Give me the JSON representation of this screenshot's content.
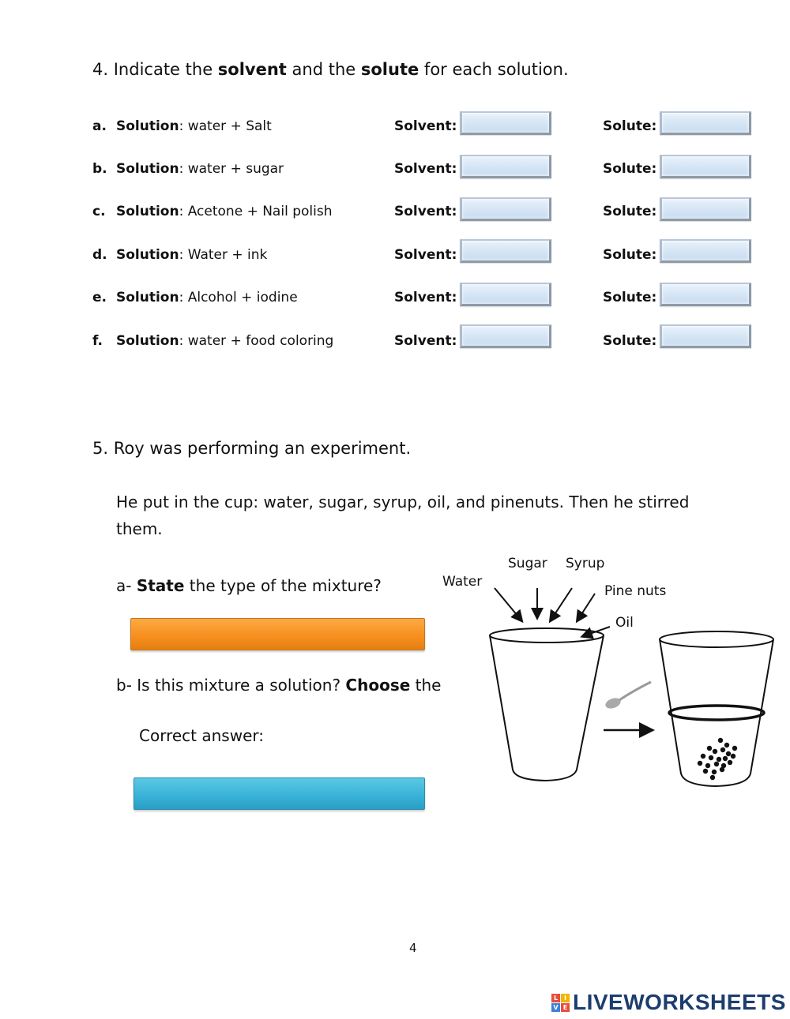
{
  "question4": {
    "number": "4.",
    "prefix": "Indicate the",
    "bold1": "solvent",
    "middle": "and the",
    "bold2": "solute",
    "suffix": "for each solution.",
    "solution_label": "Solution",
    "solvent_label": "Solvent:",
    "solute_label": "Solute:",
    "rows": [
      {
        "letter": "a.",
        "text": ": water + Salt"
      },
      {
        "letter": "b.",
        "text": ": water + sugar"
      },
      {
        "letter": "c.",
        "text": ": Acetone + Nail polish"
      },
      {
        "letter": "d.",
        "text": ": Water + ink"
      },
      {
        "letter": "e.",
        "text": ": Alcohol + iodine"
      },
      {
        "letter": "f.",
        "text": ": water + food coloring"
      }
    ]
  },
  "question5": {
    "number": "5.",
    "title": "Roy was performing an experiment.",
    "para_line1": "He put in the cup: water, sugar, syrup, oil, and pinenuts. Then he stirred",
    "para_line2": "them.",
    "part_a": {
      "prefix": "a-",
      "bold": "State",
      "suffix": "the type of the mixture?"
    },
    "part_b": {
      "prefix": "b- Is this mixture a solution?",
      "bold": "Choose",
      "suffix": "the"
    },
    "correct_answer": "Correct answer:",
    "answer_a_color": "#f7901f",
    "answer_b_color": "#3ab3d8"
  },
  "diagram": {
    "labels": {
      "water": "Water",
      "sugar": "Sugar",
      "syrup": "Syrup",
      "pine_nuts": "Pine nuts",
      "oil": "Oil"
    }
  },
  "footer": {
    "page_number": "4",
    "brand": "LIVEWORKSHEETS",
    "brand_blocks": [
      "L",
      "I",
      "V",
      "E"
    ]
  }
}
